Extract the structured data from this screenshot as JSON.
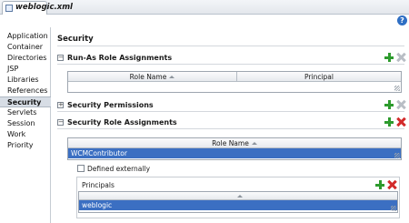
{
  "editor_tab": {
    "label": "weblogic.xml"
  },
  "help": {
    "icon": "help-icon"
  },
  "nav": {
    "items": [
      {
        "label": "Application"
      },
      {
        "label": "Container"
      },
      {
        "label": "Directories"
      },
      {
        "label": "JSP"
      },
      {
        "label": "Libraries"
      },
      {
        "label": "References"
      },
      {
        "label": "Security",
        "active": true
      },
      {
        "label": "Servlets"
      },
      {
        "label": "Session"
      },
      {
        "label": "Work Priority"
      }
    ]
  },
  "main": {
    "title": "Security",
    "run_as": {
      "title": "Run-As Role Assignments",
      "columns": [
        "Role Name",
        "Principal"
      ]
    },
    "security_permissions": {
      "title": "Security Permissions"
    },
    "security_roles": {
      "title": "Security Role Assignments",
      "column": "Role Name",
      "selected_role": "WCMContributor",
      "defined_externally_label": "Defined externally",
      "defined_externally": false,
      "principals": {
        "title": "Principals",
        "selected": "weblogic"
      }
    }
  },
  "colors": {
    "selection": "#3b6fc2",
    "add": "#2e9b2e",
    "delete_active": "#d22a2a",
    "delete_disabled": "#b9bec5"
  }
}
